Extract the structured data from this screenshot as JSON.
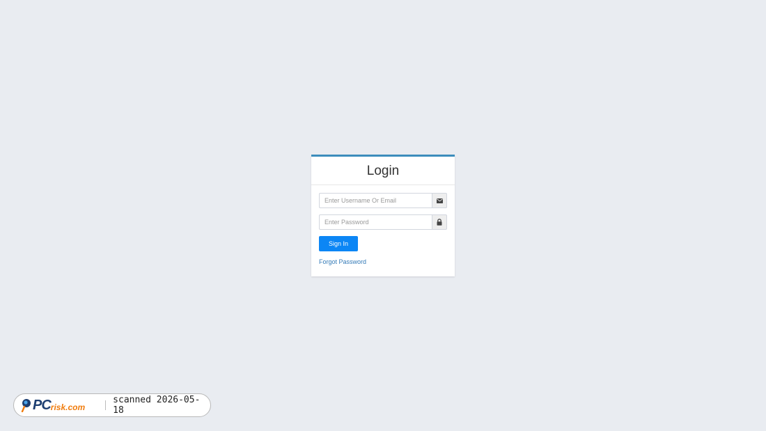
{
  "login": {
    "title": "Login",
    "username_placeholder": "Enter Username Or Email",
    "username_value": "",
    "username_icon": "envelope-icon",
    "password_placeholder": "Enter Password",
    "password_value": "",
    "password_icon": "lock-icon",
    "sign_in_label": "Sign In",
    "forgot_label": "Forgot Password"
  },
  "colors": {
    "background": "#e9ecf1",
    "card_top_border": "#3c8dbc",
    "primary_button": "#0c86f5",
    "link": "#337ab7"
  },
  "watermark": {
    "logo_pc": "PC",
    "logo_risk": "risk.com",
    "text": "scanned 2026-05-18"
  }
}
